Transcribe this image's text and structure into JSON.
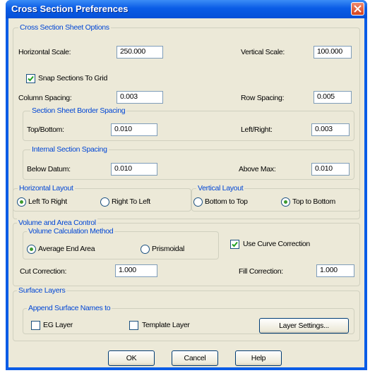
{
  "window": {
    "title": "Cross Section Preferences"
  },
  "sheet_options": {
    "legend": "Cross Section Sheet Options",
    "horizontal_scale_label": "Horizontal Scale:",
    "horizontal_scale": "250.000",
    "vertical_scale_label": "Vertical Scale:",
    "vertical_scale": "100.000",
    "snap_label": "Snap Sections To Grid",
    "snap_checked": true,
    "column_spacing_label": "Column Spacing:",
    "column_spacing": "0.003",
    "row_spacing_label": "Row Spacing:",
    "row_spacing": "0.005"
  },
  "border_spacing": {
    "legend": "Section Sheet Border Spacing",
    "top_bottom_label": "Top/Bottom:",
    "top_bottom": "0.010",
    "left_right_label": "Left/Right:",
    "left_right": "0.003"
  },
  "internal_spacing": {
    "legend": "Internal Section Spacing",
    "below_datum_label": "Below Datum:",
    "below_datum": "0.010",
    "above_max_label": "Above Max:",
    "above_max": "0.010"
  },
  "horizontal_layout": {
    "legend": "Horizontal Layout",
    "options": [
      "Left To Right",
      "Right To Left"
    ],
    "selected": "Left To Right"
  },
  "vertical_layout": {
    "legend": "Vertical Layout",
    "options": [
      "Bottom to Top",
      "Top to Bottom"
    ],
    "selected": "Top to Bottom"
  },
  "volume": {
    "legend": "Volume and Area Control",
    "method_legend": "Volume Calculation Method",
    "method_options": [
      "Average End Area",
      "Prismoidal"
    ],
    "method_selected": "Average End Area",
    "curve_label": "Use Curve Correction",
    "curve_checked": true,
    "cut_label": "Cut Correction:",
    "cut_value": "1.000",
    "fill_label": "Fill Correction:",
    "fill_value": "1.000"
  },
  "surface": {
    "legend": "Surface Layers",
    "append_legend": "Append Surface Names to",
    "eg_label": "EG Layer",
    "eg_checked": false,
    "template_label": "Template Layer",
    "template_checked": false,
    "layer_settings_label": "Layer Settings..."
  },
  "buttons": {
    "ok": "OK",
    "cancel": "Cancel",
    "help": "Help"
  }
}
